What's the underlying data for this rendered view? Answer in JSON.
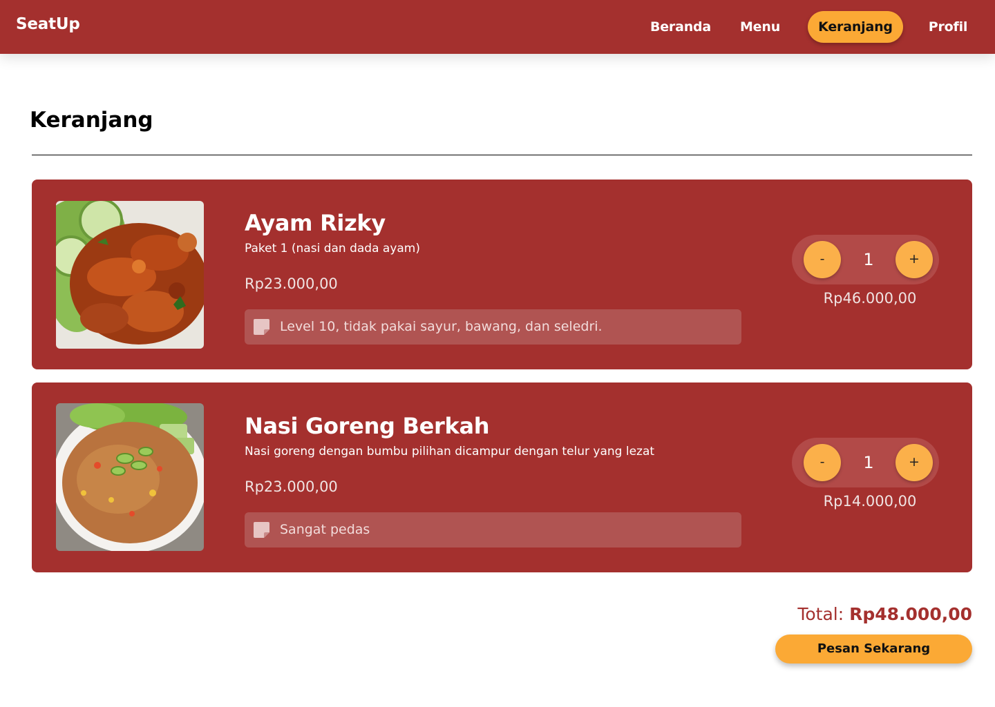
{
  "navbar": {
    "brand": "SeatUp",
    "items": [
      {
        "label": "Beranda"
      },
      {
        "label": "Menu"
      },
      {
        "label": "Keranjang",
        "active": true
      },
      {
        "label": "Profil"
      }
    ]
  },
  "page": {
    "title": "Keranjang"
  },
  "cart": {
    "items": [
      {
        "name": "Ayam Rizky",
        "description": "Paket 1 (nasi dan dada ayam)",
        "price": "Rp23.000,00",
        "note": "Level 10, tidak pakai sayur, bawang, dan seledri.",
        "minus_label": "-",
        "quantity": "1",
        "plus_label": "+",
        "subtotal": "Rp46.000,00",
        "image": "fried-chicken-photo"
      },
      {
        "name": "Nasi Goreng Berkah",
        "description": "Nasi goreng dengan bumbu pilihan dicampur dengan telur yang lezat",
        "price": "Rp23.000,00",
        "note": "Sangat pedas",
        "minus_label": "-",
        "quantity": "1",
        "plus_label": "+",
        "subtotal": "Rp14.000,00",
        "image": "fried-rice-photo"
      }
    ]
  },
  "summary": {
    "total_label": "Total: ",
    "total_value": "Rp48.000,00",
    "order_button": "Pesan Sekarang"
  },
  "colors": {
    "primary": "#A4302E",
    "accent": "#FBA935",
    "note_bg": "#B05452"
  }
}
